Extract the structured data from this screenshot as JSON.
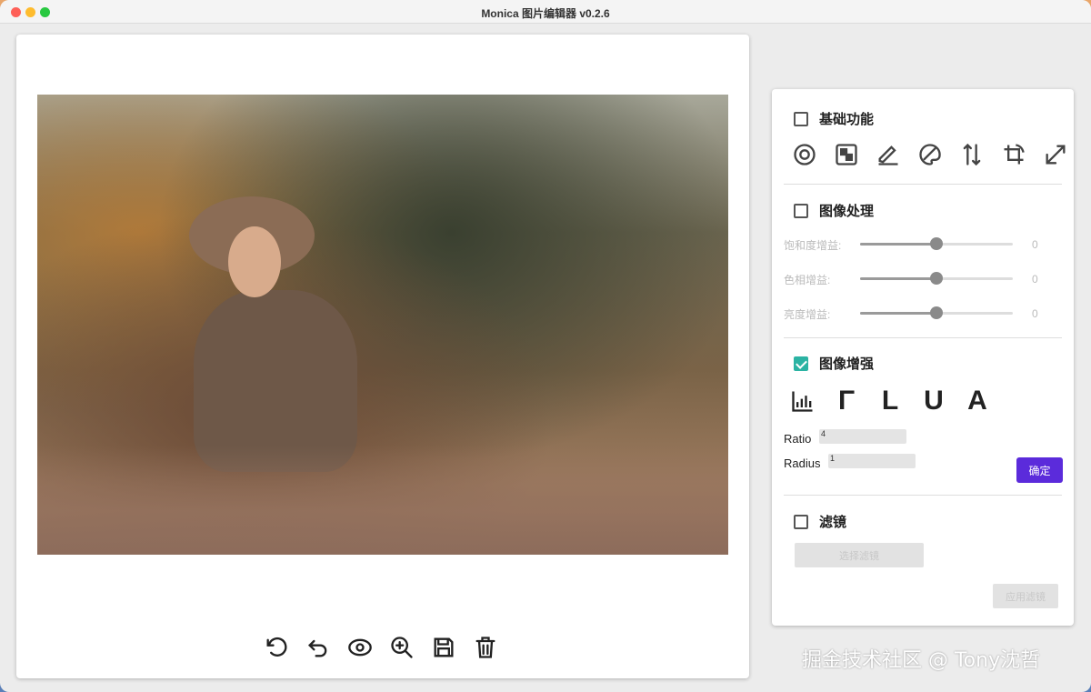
{
  "window": {
    "title": "Monica 图片编辑器 v0.2.6"
  },
  "bottom_toolbar": {
    "icons": [
      "rotate-icon",
      "undo-icon",
      "eye-icon",
      "zoom-in-icon",
      "save-icon",
      "trash-icon"
    ]
  },
  "panel": {
    "basic": {
      "label": "基础功能",
      "checked": false,
      "icons": [
        "circle-target-icon",
        "mask-icon",
        "pencil-icon",
        "palette-icon",
        "flip-vertical-icon",
        "crop-rotate-icon",
        "resize-icon"
      ]
    },
    "processing": {
      "label": "图像处理",
      "checked": false,
      "sliders": [
        {
          "label": "饱和度增益:",
          "value": "0",
          "level": 0.5
        },
        {
          "label": "色相增益:",
          "value": "0",
          "level": 0.5
        },
        {
          "label": "亮度增益:",
          "value": "0",
          "level": 0.5
        }
      ]
    },
    "enhance": {
      "label": "图像增强",
      "checked": true,
      "methods": [
        "Γ",
        "L",
        "U",
        "A"
      ],
      "ratio_label": "Ratio",
      "ratio_value": "4",
      "radius_label": "Radius",
      "radius_value": "1",
      "confirm_label": "确定"
    },
    "filter": {
      "label": "滤镜",
      "checked": false,
      "select_label": "选择滤镜",
      "apply_label": "应用滤镜"
    }
  },
  "watermark": "掘金技术社区 @ Tony沈哲",
  "colors": {
    "primary": "#5b2bdb",
    "checked": "#2bb3a3"
  }
}
